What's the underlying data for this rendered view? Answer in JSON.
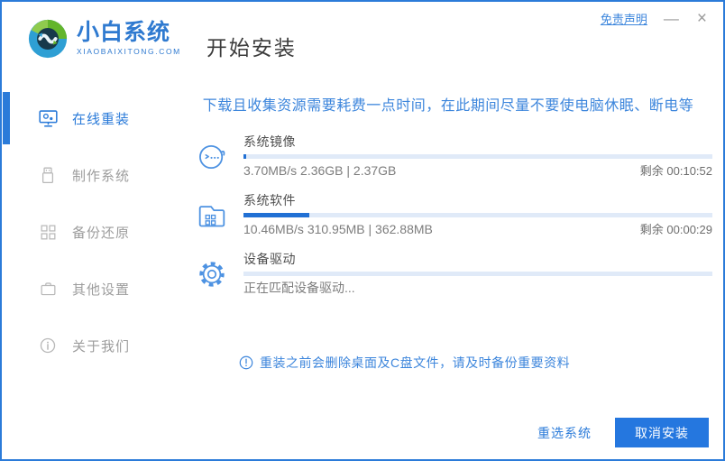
{
  "colors": {
    "accent": "#2b7bd9",
    "brand": "#2f7ad0",
    "warn": "#3d86dc",
    "btn": "#2577df",
    "fill": "#2170d4",
    "track": "#e0eaf8"
  },
  "titlebar": {
    "disclaimer": "免责声明",
    "minimize": "—",
    "close": "×"
  },
  "header": {
    "brand_name": "小白系统",
    "brand_domain": "XIAOBAIXITONG.COM",
    "page_title": "开始安装"
  },
  "sidebar": {
    "items": [
      {
        "label": "在线重装",
        "icon": "monitor-icon",
        "active": true
      },
      {
        "label": "制作系统",
        "icon": "usb-icon",
        "active": false
      },
      {
        "label": "备份还原",
        "icon": "blocks-icon",
        "active": false
      },
      {
        "label": "其他设置",
        "icon": "briefcase-icon",
        "active": false
      },
      {
        "label": "关于我们",
        "icon": "info-icon",
        "active": false
      }
    ]
  },
  "main": {
    "warning": "下载且收集资源需要耗费一点时间，在此期间尽量不要使电脑休眠、断电等",
    "tasks": [
      {
        "title": "系统镜像",
        "icon": "mascot-face-icon",
        "detail": "3.70MB/s 2.36GB | 2.37GB",
        "remaining": "剩余 00:10:52",
        "progress": 0.5
      },
      {
        "title": "系统软件",
        "icon": "folder-grid-icon",
        "detail": "10.46MB/s 310.95MB | 362.88MB",
        "remaining": "剩余 00:00:29",
        "progress": 14
      },
      {
        "title": "设备驱动",
        "icon": "gear-icon",
        "detail": "正在匹配设备驱动...",
        "remaining": "",
        "progress": 0
      }
    ],
    "notice": "重装之前会删除桌面及C盘文件，请及时备份重要资料"
  },
  "footer": {
    "reselect_label": "重选系统",
    "cancel_label": "取消安装"
  }
}
